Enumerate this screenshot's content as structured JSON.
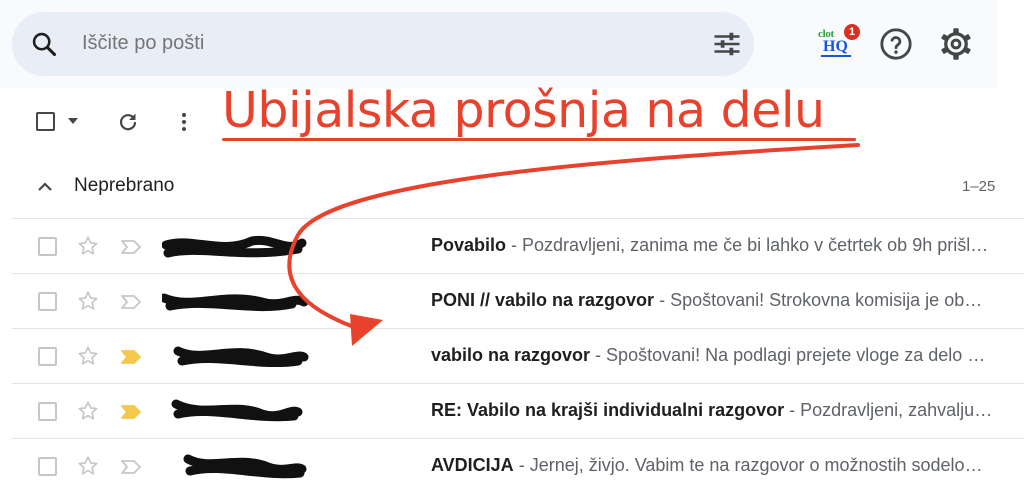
{
  "search": {
    "placeholder": "Iščite po pošti"
  },
  "header": {
    "addon_text": "clot",
    "addon_hq": "HQ",
    "addon_badge": "1"
  },
  "annotation": {
    "title": "Ubijalska prošnja na delu"
  },
  "section": {
    "title": "Neprebrano",
    "count": "1–25"
  },
  "colors": {
    "annotation": "#e8412c",
    "important": "#f2c94c",
    "search_bg": "#e9eef6"
  },
  "rows": [
    {
      "subject": "Povabilo",
      "sep": " - ",
      "snippet": "Pozdravljeni, zanima me če bi lahko v četrtek ob 9h prišl…",
      "important": false
    },
    {
      "subject": "PONI // vabilo na razgovor",
      "sep": " - ",
      "snippet": "Spoštovani! Strokovna komisija je ob…",
      "important": false
    },
    {
      "subject": "vabilo na razgovor",
      "sep": " - ",
      "snippet": "Spoštovani! Na podlagi prejete vloge za delo …",
      "important": true
    },
    {
      "subject": "RE: Vabilo na krajši individualni razgovor",
      "sep": " - ",
      "snippet": "Pozdravljeni, zahvalju…",
      "important": true
    },
    {
      "subject": "AVDICIJA",
      "sep": " - ",
      "snippet": "Jernej, živjo. Vabim te na razgovor o možnostih sodelo…",
      "important": false
    }
  ]
}
